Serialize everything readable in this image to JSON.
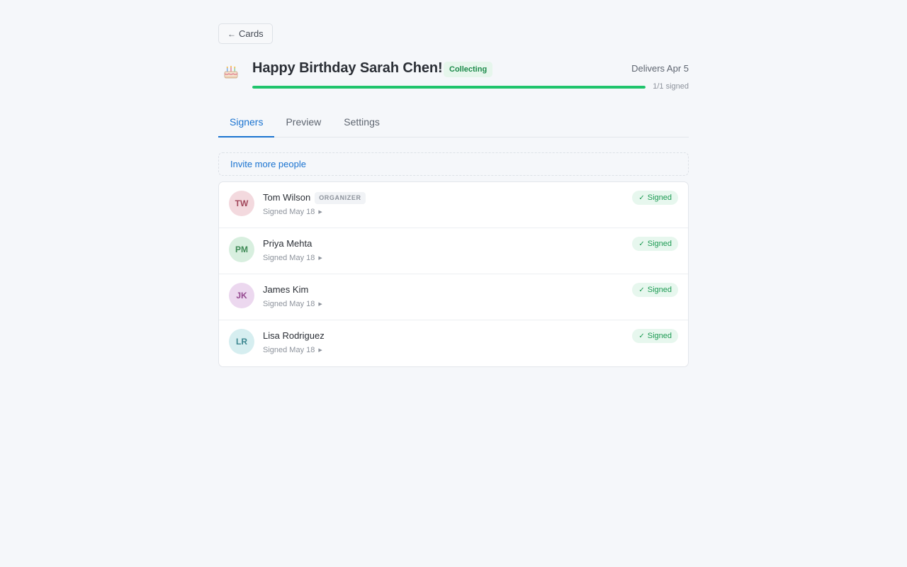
{
  "nav": {
    "back_label": "Cards"
  },
  "card": {
    "title": "Happy Birthday Sarah Chen!",
    "status": "Collecting",
    "delivers": "Delivers Apr 5",
    "progress": {
      "value": 1.0,
      "label": "1/1 signed"
    }
  },
  "tabs": [
    {
      "label": "Signers",
      "active": true
    },
    {
      "label": "Preview",
      "active": false
    },
    {
      "label": "Settings",
      "active": false
    }
  ],
  "invite_label": "Invite more people",
  "signers": [
    {
      "initials": "TW",
      "name": "Tom Wilson",
      "role": "ORGANIZER",
      "signed_date": "Signed May 18",
      "status": "Signed",
      "avatar_bg": "#f3d9de",
      "avatar_fg": "#a2485c"
    },
    {
      "initials": "PM",
      "name": "Priya Mehta",
      "role": "",
      "signed_date": "Signed May 18",
      "status": "Signed",
      "avatar_bg": "#d8efdf",
      "avatar_fg": "#3f8a56"
    },
    {
      "initials": "JK",
      "name": "James Kim",
      "role": "",
      "signed_date": "Signed May 18",
      "status": "Signed",
      "avatar_bg": "#ecd8ef",
      "avatar_fg": "#94488f"
    },
    {
      "initials": "LR",
      "name": "Lisa Rodriguez",
      "role": "",
      "signed_date": "Signed May 18",
      "status": "Signed",
      "avatar_bg": "#d6eef0",
      "avatar_fg": "#3c8790"
    }
  ],
  "icons": {
    "back": "arrow-left-icon",
    "card": "cake-icon",
    "signed": "check-icon",
    "expand": "triangle-right-icon"
  },
  "colors": {
    "accent": "#1a73d0",
    "progress": "#1fc46c",
    "signed": "#1c9a52"
  }
}
